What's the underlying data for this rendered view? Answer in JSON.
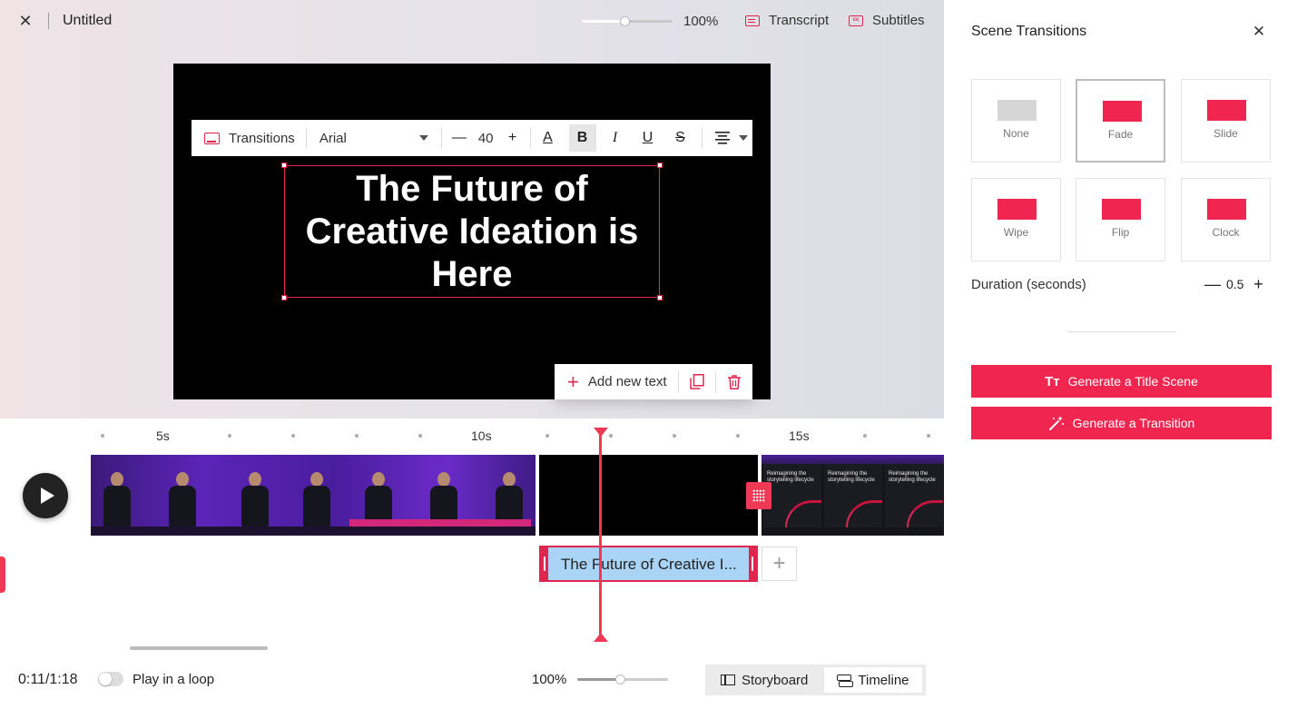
{
  "topbar": {
    "close_icon": "close-icon",
    "title": "Untitled",
    "zoom_value": 0.47,
    "zoom_label": "100%",
    "transcript_label": "Transcript",
    "subtitles_label": "Subtitles"
  },
  "format_bar": {
    "transitions_label": "Transitions",
    "font_family": "Arial",
    "font_size": "40",
    "text_color_label": "A",
    "bold_label": "B",
    "italic_label": "I",
    "underline_label": "U",
    "strike_label": "S",
    "align_icon": "align-center-icon"
  },
  "canvas": {
    "text": "The Future of\nCreative Ideation is\nHere"
  },
  "add_bar": {
    "add_label": "Add new text",
    "duplicate_icon": "copy-icon",
    "delete_icon": "trash-icon"
  },
  "timeline": {
    "ruler_labels": [
      "5s",
      "10s",
      "15s"
    ],
    "text_clip_label": "The Future of Creative I...",
    "slide_caption": "Reimagining the storytelling lifecycle",
    "playhead_time": "0:11"
  },
  "bottom_bar": {
    "time": "0:11/1:18",
    "loop_label": "Play in a loop",
    "loop_on": false,
    "zoom_label": "100%",
    "zoom_value": 0.47,
    "storyboard_label": "Storyboard",
    "timeline_label": "Timeline",
    "active_view": "Timeline"
  },
  "panel": {
    "title": "Scene Transitions",
    "transitions": [
      {
        "label": "None",
        "color": "#d6d6d6",
        "selected": false
      },
      {
        "label": "Fade",
        "color": "#f02650",
        "selected": true
      },
      {
        "label": "Slide",
        "color": "#f02650",
        "selected": false
      },
      {
        "label": "Wipe",
        "color": "#f02650",
        "selected": false
      },
      {
        "label": "Flip",
        "color": "#f02650",
        "selected": false
      },
      {
        "label": "Clock",
        "color": "#f02650",
        "selected": false
      }
    ],
    "duration_label": "Duration (seconds)",
    "duration_value": "0.5",
    "generate_title_label": "Generate a Title Scene",
    "generate_transition_label": "Generate a Transition"
  },
  "colors": {
    "accent": "#f02650",
    "text_clip_bg": "#aad4f5",
    "canvas_bg": "#000000"
  }
}
